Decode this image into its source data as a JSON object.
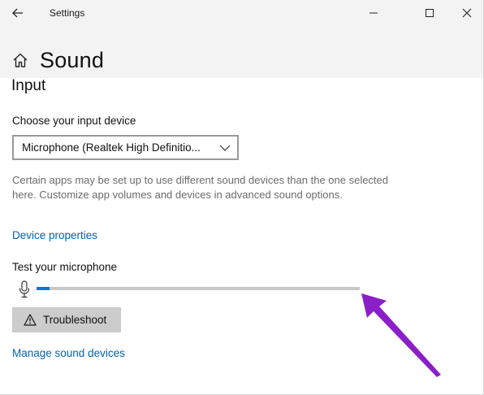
{
  "window": {
    "title": "Settings"
  },
  "page": {
    "title": "Sound",
    "section": "Input"
  },
  "input": {
    "device_label": "Choose your input device",
    "device_value": "Microphone (Realtek High Definitio...",
    "description": "Certain apps may be set up to use different sound devices than the one selected here. Customize app volumes and devices in advanced sound options.",
    "device_properties_link": "Device properties",
    "test_label": "Test your microphone",
    "level_fraction": 0.04,
    "troubleshoot_label": "Troubleshoot",
    "manage_link": "Manage sound devices"
  },
  "colors": {
    "accent": "#0078d7",
    "link": "#0063b1",
    "annotation_arrow": "#8b1fc7"
  },
  "icons": [
    "back-arrow-icon",
    "minimize-icon",
    "maximize-icon",
    "close-icon",
    "home-icon",
    "chevron-down-icon",
    "microphone-icon",
    "warning-icon"
  ]
}
